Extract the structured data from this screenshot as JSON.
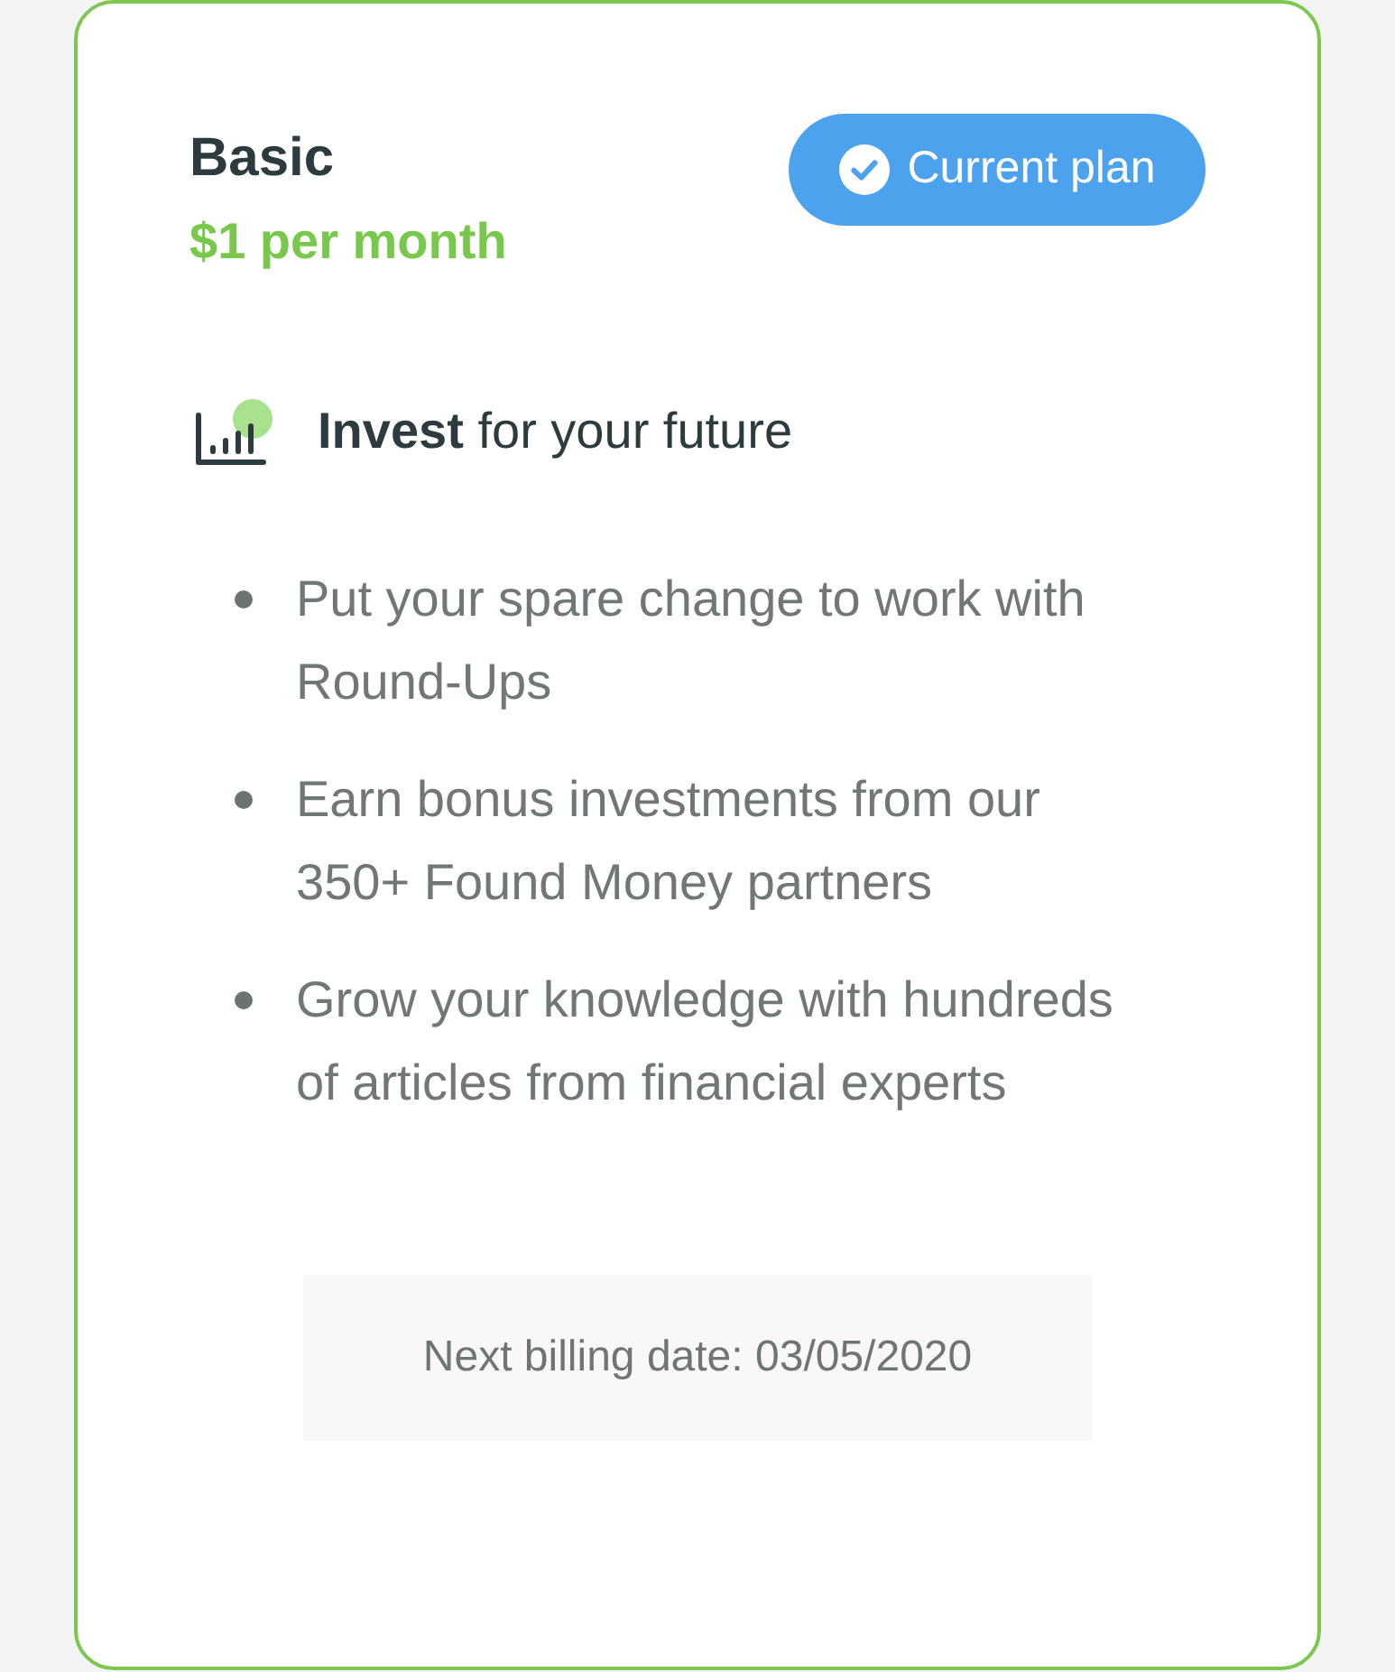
{
  "plan": {
    "name": "Basic",
    "price": "$1 per month"
  },
  "status_badge": {
    "label": "Current plan"
  },
  "feature": {
    "heading": "**Invest** for your future",
    "bullets": [
      "Put your spare change to work with Round-Ups",
      "Earn bonus investments from our 350+ Found Money partners",
      "Grow your knowledge with hundreds of articles from financial experts"
    ]
  },
  "billing": {
    "text": "Next billing date: 03/05/2020"
  }
}
